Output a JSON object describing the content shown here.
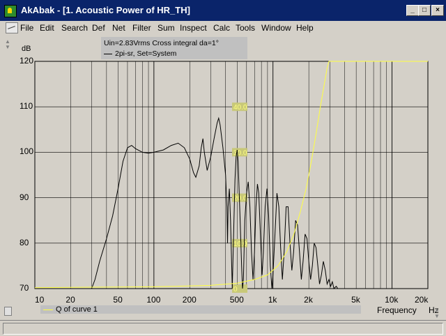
{
  "window": {
    "title": "AkAbak - [1. Acoustic Power of HR_TH]",
    "caption_buttons": [
      "_",
      "□",
      "×"
    ]
  },
  "menu": {
    "items": [
      {
        "label": "File",
        "key": "file"
      },
      {
        "label": "Edit",
        "key": "edit"
      },
      {
        "label": "Search",
        "key": "search"
      },
      {
        "label": "Def",
        "key": "def"
      },
      {
        "label": "Net",
        "key": "net"
      },
      {
        "label": "Filter",
        "key": "filter"
      },
      {
        "label": "Sum",
        "key": "sum"
      },
      {
        "label": "Inspect",
        "key": "inspect"
      },
      {
        "label": "Calc",
        "key": "calc"
      },
      {
        "label": "Tools",
        "key": "tools"
      },
      {
        "label": "Window",
        "key": "window"
      },
      {
        "label": "Help",
        "key": "help"
      }
    ],
    "mdi_buttons": [
      "_",
      "▫",
      "×"
    ]
  },
  "plot": {
    "y_unit": "dB",
    "info_line1": "Uin=2.83Vrms Cross integral da=1°",
    "info_line2": "2pi-sr, Set=System",
    "x_unit": "Hz",
    "x_title": "Frequency",
    "legend": "Q of curve 1",
    "colors": {
      "background": "#d4d0c8",
      "grid": "#000000",
      "curve": "#000000",
      "q_curve": "#ffff40",
      "q_labels_bg": "#c8c878"
    }
  },
  "chart_data": {
    "type": "line",
    "x_scale": "log",
    "xlim": [
      10,
      20000
    ],
    "ylim": [
      70,
      120
    ],
    "ylabel": "dB",
    "xlabel": "Frequency",
    "y_ticks": [
      70,
      80,
      90,
      100,
      110,
      120
    ],
    "x_ticks": [
      {
        "value": 10,
        "label": "10"
      },
      {
        "value": 20,
        "label": "20"
      },
      {
        "value": 50,
        "label": "50"
      },
      {
        "value": 100,
        "label": "100"
      },
      {
        "value": 200,
        "label": "200"
      },
      {
        "value": 500,
        "label": "500"
      },
      {
        "value": 1000,
        "label": "1k"
      },
      {
        "value": 2000,
        "label": "2k"
      },
      {
        "value": 5000,
        "label": "5k"
      },
      {
        "value": 10000,
        "label": "10k"
      },
      {
        "value": 20000,
        "label": "20k"
      }
    ],
    "q_axis_labels": [
      {
        "y": 110,
        "label": "40.0"
      },
      {
        "y": 100,
        "label": "30.0"
      },
      {
        "y": 90,
        "label": "20.0"
      },
      {
        "y": 80,
        "label": "10.0"
      },
      {
        "y": 70,
        "label": "0"
      }
    ],
    "series": [
      {
        "key": "power",
        "color": "#000000",
        "points": [
          [
            30,
            70
          ],
          [
            32,
            72
          ],
          [
            35,
            76
          ],
          [
            40,
            81
          ],
          [
            45,
            86
          ],
          [
            50,
            92
          ],
          [
            55,
            98
          ],
          [
            60,
            101
          ],
          [
            65,
            101.5
          ],
          [
            70,
            100.8
          ],
          [
            80,
            100
          ],
          [
            90,
            99.8
          ],
          [
            100,
            100
          ],
          [
            120,
            100.5
          ],
          [
            140,
            101.5
          ],
          [
            160,
            102
          ],
          [
            180,
            101
          ],
          [
            200,
            98.5
          ],
          [
            215,
            95.5
          ],
          [
            225,
            94.5
          ],
          [
            240,
            97
          ],
          [
            250,
            101
          ],
          [
            258,
            103
          ],
          [
            265,
            100
          ],
          [
            280,
            96
          ],
          [
            300,
            99
          ],
          [
            320,
            103
          ],
          [
            340,
            106.5
          ],
          [
            350,
            107.5
          ],
          [
            360,
            106
          ],
          [
            380,
            101
          ],
          [
            400,
            95
          ],
          [
            410,
            88
          ],
          [
            415,
            80
          ],
          [
            420,
            88
          ],
          [
            430,
            92
          ],
          [
            440,
            85
          ],
          [
            450,
            75
          ],
          [
            455,
            70
          ],
          [
            460,
            75
          ],
          [
            470,
            85
          ],
          [
            480,
            94
          ],
          [
            490,
            99
          ],
          [
            500,
            100.5
          ],
          [
            510,
            98
          ],
          [
            530,
            85
          ],
          [
            545,
            75
          ],
          [
            555,
            70
          ],
          [
            565,
            72
          ],
          [
            580,
            85
          ],
          [
            600,
            91
          ],
          [
            620,
            93.5
          ],
          [
            640,
            88
          ],
          [
            660,
            78
          ],
          [
            680,
            72
          ],
          [
            700,
            78
          ],
          [
            720,
            88
          ],
          [
            740,
            93
          ],
          [
            760,
            91
          ],
          [
            790,
            80
          ],
          [
            810,
            73
          ],
          [
            830,
            78
          ],
          [
            860,
            88
          ],
          [
            890,
            92
          ],
          [
            920,
            86
          ],
          [
            950,
            75
          ],
          [
            980,
            70
          ],
          [
            1000,
            73
          ],
          [
            1040,
            82
          ],
          [
            1080,
            91
          ],
          [
            1120,
            88
          ],
          [
            1160,
            79
          ],
          [
            1200,
            72
          ],
          [
            1240,
            78
          ],
          [
            1290,
            88
          ],
          [
            1340,
            88
          ],
          [
            1390,
            80
          ],
          [
            1440,
            74
          ],
          [
            1490,
            78
          ],
          [
            1550,
            85
          ],
          [
            1610,
            84
          ],
          [
            1670,
            78
          ],
          [
            1730,
            72
          ],
          [
            1790,
            76
          ],
          [
            1860,
            82
          ],
          [
            1930,
            81
          ],
          [
            2000,
            76
          ],
          [
            2070,
            72
          ],
          [
            2140,
            75
          ],
          [
            2220,
            80
          ],
          [
            2300,
            79
          ],
          [
            2380,
            75
          ],
          [
            2460,
            71
          ],
          [
            2550,
            73
          ],
          [
            2650,
            76
          ],
          [
            2750,
            74
          ],
          [
            2850,
            71
          ],
          [
            2950,
            72
          ],
          [
            3050,
            70.5
          ],
          [
            3150,
            71.5
          ],
          [
            3250,
            70
          ],
          [
            3400,
            70.5
          ],
          [
            3500,
            70
          ]
        ]
      },
      {
        "key": "q",
        "color": "#ffff40",
        "points": [
          [
            10,
            70.2
          ],
          [
            30,
            70.3
          ],
          [
            100,
            70.4
          ],
          [
            300,
            70.7
          ],
          [
            500,
            71.2
          ],
          [
            700,
            72
          ],
          [
            900,
            73
          ],
          [
            1100,
            75
          ],
          [
            1300,
            78
          ],
          [
            1500,
            82
          ],
          [
            1700,
            87
          ],
          [
            1900,
            92
          ],
          [
            2100,
            98
          ],
          [
            2300,
            104
          ],
          [
            2500,
            110
          ],
          [
            2700,
            115
          ],
          [
            2850,
            118.5
          ],
          [
            2950,
            120
          ],
          [
            20000,
            120
          ]
        ]
      }
    ]
  }
}
